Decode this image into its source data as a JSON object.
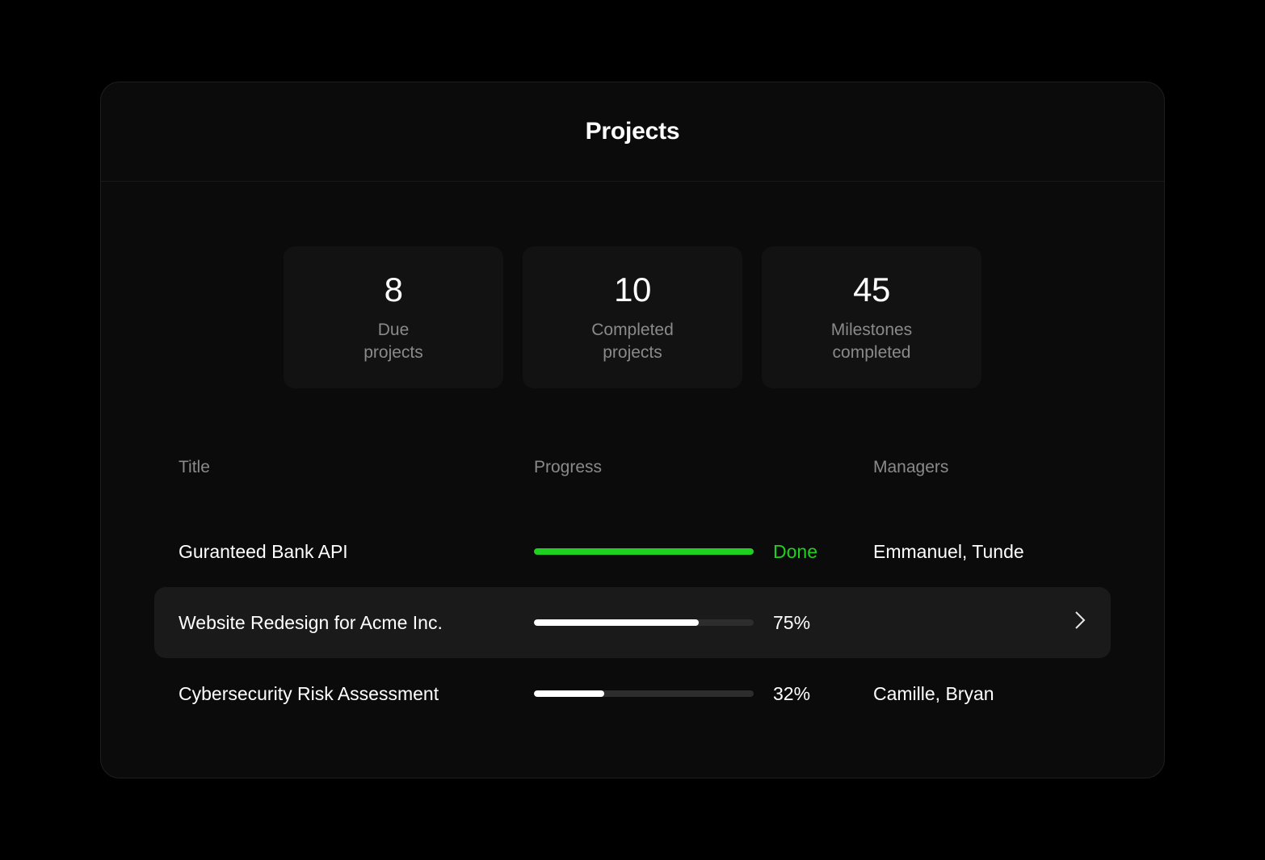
{
  "header": {
    "title": "Projects"
  },
  "stats": [
    {
      "value": "8",
      "label": "Due\nprojects"
    },
    {
      "value": "10",
      "label": "Completed\nprojects"
    },
    {
      "value": "45",
      "label": "Milestones\ncompleted"
    }
  ],
  "table": {
    "headers": {
      "title": "Title",
      "progress": "Progress",
      "managers": "Managers"
    },
    "rows": [
      {
        "title": "Guranteed Bank API",
        "progress_pct": 100,
        "progress_label": "Done",
        "status": "done",
        "managers": "Emmanuel, Tunde",
        "highlighted": false,
        "chevron": false
      },
      {
        "title": "Website Redesign for Acme Inc.",
        "progress_pct": 75,
        "progress_label": "75%",
        "status": "in-progress",
        "managers": "",
        "highlighted": true,
        "chevron": true
      },
      {
        "title": "Cybersecurity Risk Assessment",
        "progress_pct": 32,
        "progress_label": "32%",
        "status": "in-progress",
        "managers": "Camille, Bryan",
        "highlighted": false,
        "chevron": false
      }
    ]
  },
  "colors": {
    "accent_done": "#1fd11f",
    "bar_track": "#2d2d2d",
    "bar_fill": "#ffffff"
  }
}
